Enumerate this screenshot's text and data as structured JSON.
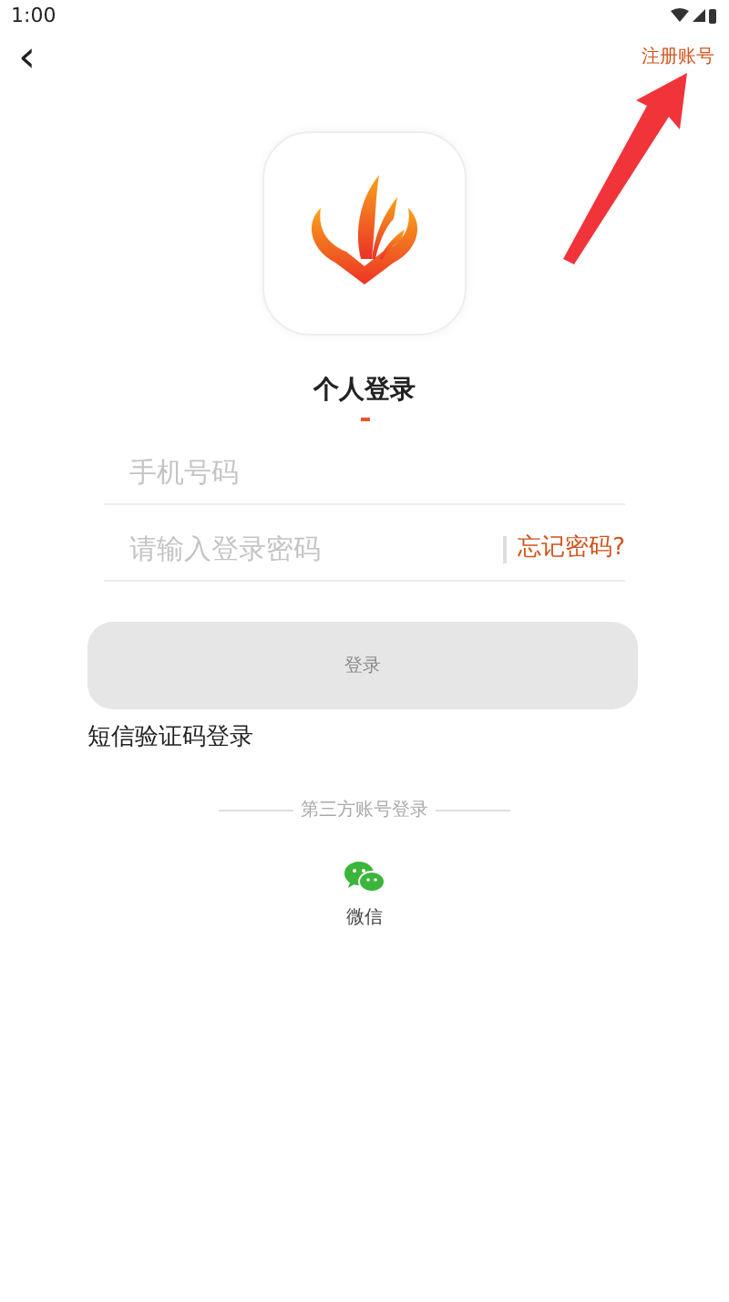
{
  "status_bar": {
    "time": "1:00"
  },
  "header": {
    "back": "‹",
    "register": "注册账号"
  },
  "title": "个人登录",
  "fields": [
    {
      "placeholder": "手机号码"
    },
    {
      "placeholder": "请输入登录密码",
      "link": "忘记密码?"
    }
  ],
  "login_button": {
    "label": "登录",
    "disabled": true
  },
  "sms_login": "短信验证码登录",
  "third_party": {
    "divider_label": "第三方账号登录",
    "options": [
      {
        "label": "微信"
      }
    ]
  }
}
